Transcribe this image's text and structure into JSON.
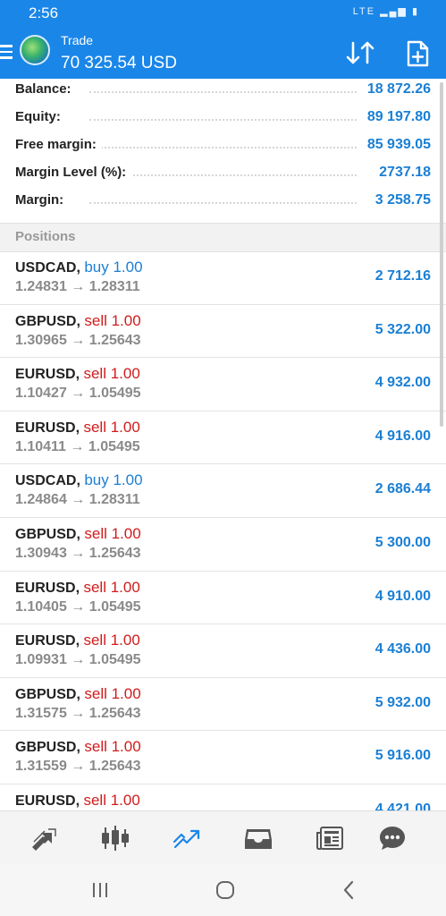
{
  "status": {
    "time": "2:56",
    "network": "LTE"
  },
  "header": {
    "title": "Trade",
    "subtitle": "70 325.54 USD"
  },
  "summary": [
    {
      "label": "Balance:",
      "value": "18 872.26"
    },
    {
      "label": "Equity:",
      "value": "89 197.80"
    },
    {
      "label": "Free margin:",
      "value": "85 939.05"
    },
    {
      "label": "Margin Level (%):",
      "value": "2737.18"
    },
    {
      "label": "Margin:",
      "value": "3 258.75"
    }
  ],
  "positions_header": "Positions",
  "positions": [
    {
      "symbol": "USDCAD,",
      "type": "buy 1.00",
      "side": "buy",
      "prices": "1.24831 → 1.28311",
      "profit": "2 712.16"
    },
    {
      "symbol": "GBPUSD,",
      "type": "sell 1.00",
      "side": "sell",
      "prices": "1.30965 → 1.25643",
      "profit": "5 322.00"
    },
    {
      "symbol": "EURUSD,",
      "type": "sell 1.00",
      "side": "sell",
      "prices": "1.10427 → 1.05495",
      "profit": "4 932.00"
    },
    {
      "symbol": "EURUSD,",
      "type": "sell 1.00",
      "side": "sell",
      "prices": "1.10411 → 1.05495",
      "profit": "4 916.00"
    },
    {
      "symbol": "USDCAD,",
      "type": "buy 1.00",
      "side": "buy",
      "prices": "1.24864 → 1.28311",
      "profit": "2 686.44"
    },
    {
      "symbol": "GBPUSD,",
      "type": "sell 1.00",
      "side": "sell",
      "prices": "1.30943 → 1.25643",
      "profit": "5 300.00"
    },
    {
      "symbol": "EURUSD,",
      "type": "sell 1.00",
      "side": "sell",
      "prices": "1.10405 → 1.05495",
      "profit": "4 910.00"
    },
    {
      "symbol": "EURUSD,",
      "type": "sell 1.00",
      "side": "sell",
      "prices": "1.09931 → 1.05495",
      "profit": "4 436.00"
    },
    {
      "symbol": "GBPUSD,",
      "type": "sell 1.00",
      "side": "sell",
      "prices": "1.31575 → 1.25643",
      "profit": "5 932.00"
    },
    {
      "symbol": "GBPUSD,",
      "type": "sell 1.00",
      "side": "sell",
      "prices": "1.31559 → 1.25643",
      "profit": "5 916.00"
    },
    {
      "symbol": "EURUSD,",
      "type": "sell 1.00",
      "side": "sell",
      "prices": "",
      "profit": "4 421.00"
    }
  ],
  "bottom_nav": [
    {
      "icon": "quotes-icon",
      "active": false
    },
    {
      "icon": "chart-icon",
      "active": false
    },
    {
      "icon": "trade-icon",
      "active": true
    },
    {
      "icon": "history-icon",
      "active": false
    },
    {
      "icon": "news-icon",
      "active": false
    },
    {
      "icon": "chat-icon",
      "active": false
    }
  ],
  "colors": {
    "accent": "#1a86e8",
    "buy": "#1a7fd4",
    "sell": "#d01c1c",
    "profit": "#1a7fd4"
  }
}
